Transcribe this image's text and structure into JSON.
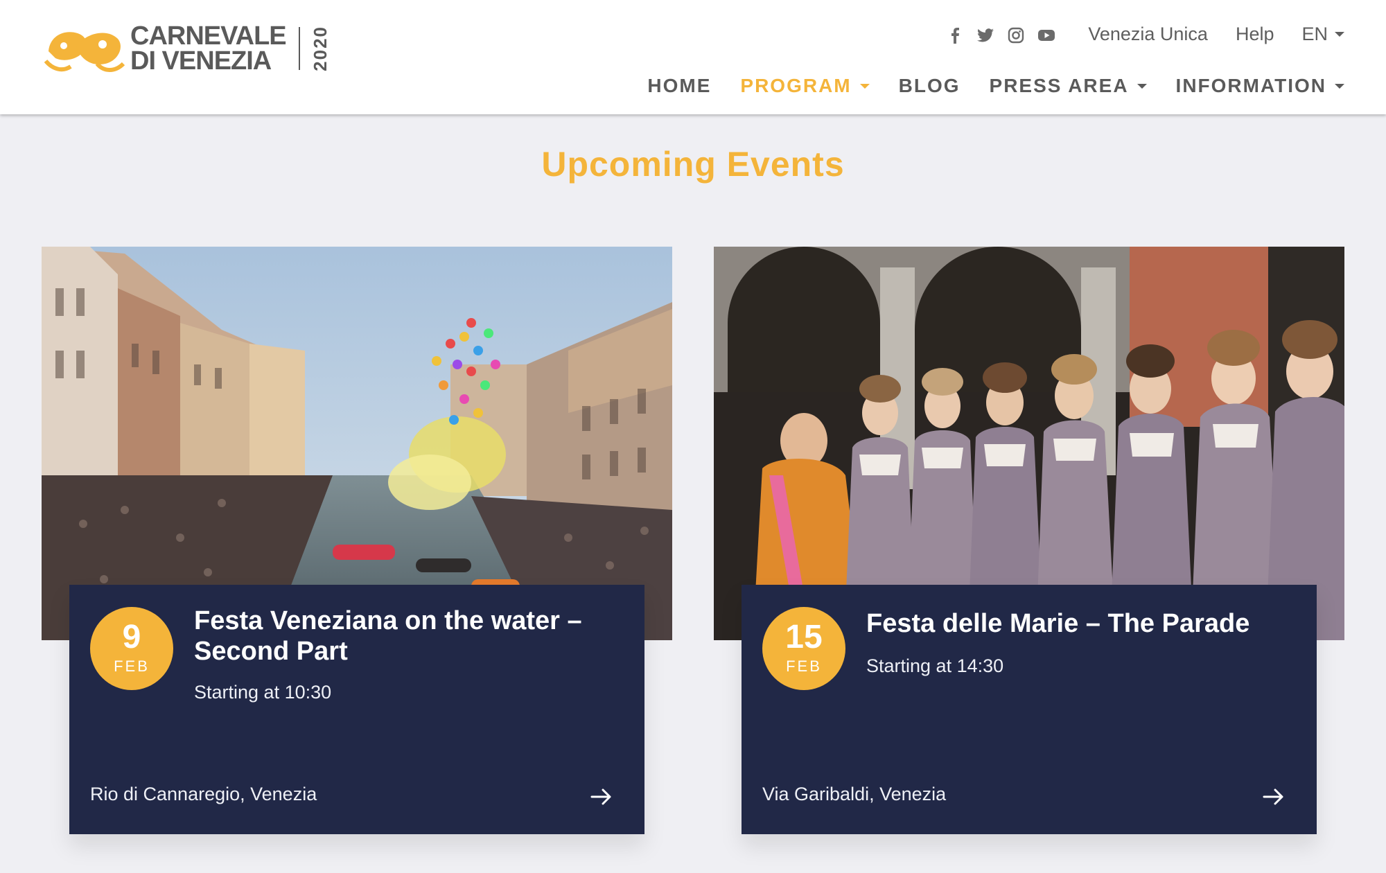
{
  "header": {
    "logo": {
      "line1": "CARNEVALE",
      "line2": "DI VENEZIA",
      "year": "2020"
    },
    "social_icons": [
      "facebook-icon",
      "twitter-icon",
      "instagram-icon",
      "youtube-icon"
    ],
    "toplinks": [
      "Venezia Unica",
      "Help"
    ],
    "language": "EN",
    "nav": [
      {
        "label": "HOME",
        "dropdown": false,
        "active": false
      },
      {
        "label": "PROGRAM",
        "dropdown": true,
        "active": true
      },
      {
        "label": "BLOG",
        "dropdown": false,
        "active": false
      },
      {
        "label": "PRESS AREA",
        "dropdown": true,
        "active": false
      },
      {
        "label": "INFORMATION",
        "dropdown": true,
        "active": false
      }
    ]
  },
  "section": {
    "title": "Upcoming Events"
  },
  "events": [
    {
      "day": "9",
      "month": "FEB",
      "title": "Festa Veneziana on the water – Second Part",
      "time": "Starting at 10:30",
      "location": "Rio di Cannaregio, Venezia"
    },
    {
      "day": "15",
      "month": "FEB",
      "title": "Festa delle Marie – The Parade",
      "time": "Starting at 14:30",
      "location": "Via Garibaldi, Venezia"
    }
  ],
  "colors": {
    "accent": "#f4b43a",
    "card": "#212847",
    "background": "#efeff3"
  }
}
